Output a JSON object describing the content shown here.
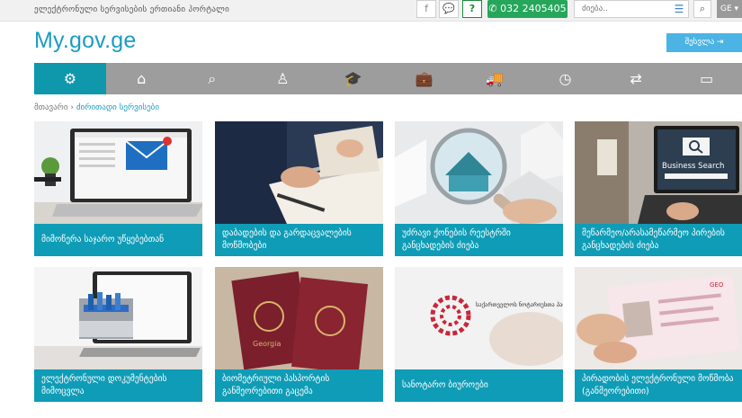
{
  "topbar": {
    "tagline": "ელექტრონული სერვისების ერთიანი პორტალი",
    "help": "?",
    "phone": "032 2405405",
    "search_placeholder": "ძიება..",
    "lang": "GE ▾"
  },
  "header": {
    "logo": "My.gov.ge",
    "login": "შესვლა ⇥"
  },
  "breadcrumb": {
    "home": "მთავარი",
    "sep": "›",
    "current": "ძირითადი სერვისები"
  },
  "cards": [
    {
      "label": "მიმოწერა საჯარო უწყებებთან"
    },
    {
      "label": "დაბადების და გარდაცვალების მოწმობები"
    },
    {
      "label": "უძრავი ქონების რეესტრში განცხადების ძიება"
    },
    {
      "label": "მეწარმეო/არასამეწარმეო პირების განცხადების ძიება"
    },
    {
      "label": "ელექტრონული დოკუმენტების მიმოცვლა"
    },
    {
      "label": "ბიომეტრიული პასპორტის განმეორებითი გაცემა"
    },
    {
      "label": "სანოტარო ბიუროები"
    },
    {
      "label": "პირადობის ელექტრონული მოწმობა (განმეორებითი)"
    }
  ],
  "card_texts": {
    "business_search": "Business Search",
    "passport_top": "Georgia",
    "notary_title": "საქართველოს ნოტარიუსთა პალატა",
    "id_badge": "GEO"
  }
}
